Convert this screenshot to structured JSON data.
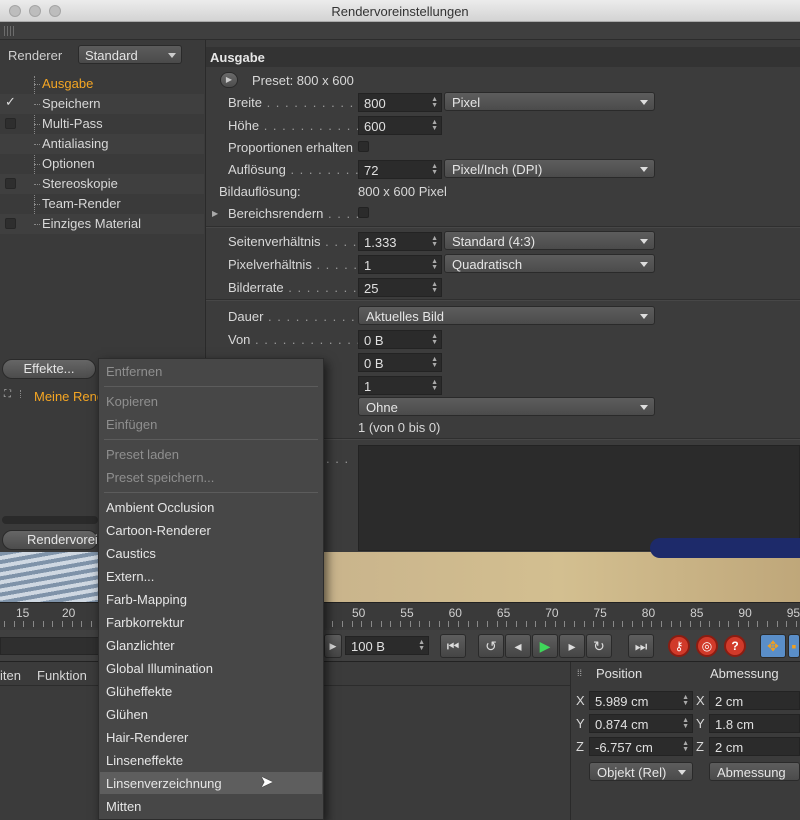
{
  "window": {
    "title": "Rendervoreinstellungen"
  },
  "left": {
    "renderer_label": "Renderer",
    "renderer_value": "Standard",
    "items": [
      {
        "label": "Ausgabe",
        "active": true,
        "checkbox": "none"
      },
      {
        "label": "Speichern",
        "checkbox": "checked"
      },
      {
        "label": "Multi-Pass",
        "checkbox": "unchecked"
      },
      {
        "label": "Antialiasing",
        "checkbox": "none"
      },
      {
        "label": "Optionen",
        "checkbox": "none"
      },
      {
        "label": "Stereoskopie",
        "checkbox": "unchecked"
      },
      {
        "label": "Team-Render",
        "checkbox": "none"
      },
      {
        "label": "Einziges Material",
        "checkbox": "unchecked"
      }
    ],
    "effects_button": "Effekte...",
    "my_render": "Meine Rend",
    "render_button": "Rendervorei"
  },
  "output": {
    "section_title": "Ausgabe",
    "preset": "Preset: 800 x 600",
    "width_label": "Breite",
    "width_value": "800",
    "width_unit": "Pixel",
    "height_label": "Höhe",
    "height_value": "600",
    "keep_prop_label": "Proportionen erhalten",
    "res_label": "Auflösung",
    "res_value": "72",
    "res_unit": "Pixel/Inch (DPI)",
    "img_res_label": "Bildauflösung:",
    "img_res_value": "800 x 600 Pixel",
    "region_label": "Bereichsrendern",
    "aspect_label": "Seitenverhältnis",
    "aspect_value": "1.333",
    "aspect_preset": "Standard (4:3)",
    "pixel_aspect_label": "Pixelverhältnis",
    "pixel_aspect_value": "1",
    "pixel_aspect_preset": "Quadratisch",
    "framerate_label": "Bilderrate",
    "framerate_value": "25",
    "duration_label": "Dauer",
    "duration_value": "Aktuelles Bild",
    "from_label": "Von",
    "from_value": "0 B",
    "to_value": "0 B",
    "step_value": "1",
    "field_value": "Ohne",
    "frames_text": "1 (von 0 bis 0)"
  },
  "menu": {
    "items": [
      {
        "label": "Entfernen",
        "disabled": true
      },
      {
        "label": "Kopieren",
        "disabled": true
      },
      {
        "label": "Einfügen",
        "disabled": true
      },
      {
        "label": "Preset laden",
        "disabled": true
      },
      {
        "label": "Preset speichern...",
        "disabled": true
      },
      {
        "label": "Ambient Occlusion"
      },
      {
        "label": "Cartoon-Renderer"
      },
      {
        "label": "Caustics"
      },
      {
        "label": "Extern..."
      },
      {
        "label": "Farb-Mapping"
      },
      {
        "label": "Farbkorrektur"
      },
      {
        "label": "Glanzlichter"
      },
      {
        "label": "Global Illumination"
      },
      {
        "label": "Glüheffekte"
      },
      {
        "label": "Glühen"
      },
      {
        "label": "Hair-Renderer"
      },
      {
        "label": "Linseneffekte"
      },
      {
        "label": "Linsenverzeichnung",
        "highlighted": true
      },
      {
        "label": "Mitten"
      }
    ]
  },
  "timeline": {
    "ticks_left": [
      "15",
      "20"
    ],
    "ticks_right": [
      "50",
      "55",
      "60",
      "65",
      "70",
      "75",
      "80",
      "85",
      "90",
      "95"
    ],
    "frame_field": "100 B"
  },
  "bottom": {
    "menu_items": [
      "iten",
      "Funktion"
    ],
    "position_header": "Position",
    "size_header": "Abmessung",
    "px": "5.989 cm",
    "py": "0.874 cm",
    "pz": "-6.757 cm",
    "sx": "2 cm",
    "sy": "1.8 cm",
    "sz": "2 cm",
    "axis_x": "X",
    "axis_y": "Y",
    "axis_z": "Z",
    "obj_mode": "Objekt (Rel)",
    "size_mode": "Abmessung"
  },
  "colors": {
    "accent": "#f5a623",
    "bg": "#3b3b3b",
    "play": "#3fd65a",
    "record": "#d13a2a",
    "move_tool": "#f0a020"
  }
}
